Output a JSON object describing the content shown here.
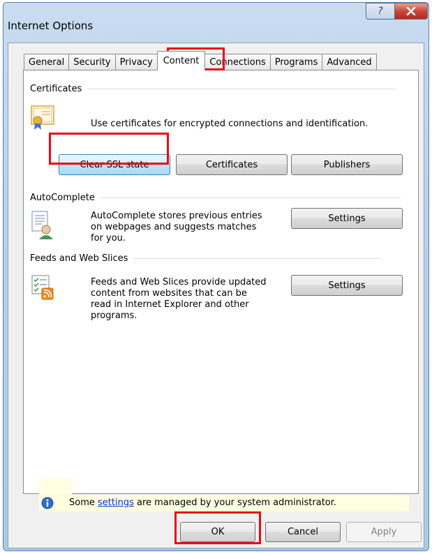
{
  "window": {
    "title": "Internet Options"
  },
  "titlebar": {
    "help_glyph": "?",
    "close_glyph": "X"
  },
  "tabs": [
    {
      "label": "General"
    },
    {
      "label": "Security"
    },
    {
      "label": "Privacy"
    },
    {
      "label": "Content"
    },
    {
      "label": "Connections"
    },
    {
      "label": "Programs"
    },
    {
      "label": "Advanced"
    }
  ],
  "active_tab": "Content",
  "certificates": {
    "heading": "Certificates",
    "description": "Use certificates for encrypted connections and identification.",
    "clear_ssl_label": "Clear SSL state",
    "certificates_label": "Certificates",
    "publishers_label": "Publishers"
  },
  "autocomplete": {
    "heading": "AutoComplete",
    "description_line1": "AutoComplete stores previous entries",
    "description_line2": "on webpages and suggests matches",
    "description_line3": "for you.",
    "settings_label": "Settings"
  },
  "feeds": {
    "heading": "Feeds and Web Slices",
    "description_line1": "Feeds and Web Slices provide updated",
    "description_line2": "content from websites that can be",
    "description_line3": "read in Internet Explorer and other",
    "description_line4": "programs.",
    "settings_label": "Settings"
  },
  "info": {
    "text_before": "Some ",
    "link": "settings",
    "text_after": " are managed by your system administrator."
  },
  "footer": {
    "ok_label": "OK",
    "cancel_label": "Cancel",
    "apply_label": "Apply"
  },
  "colors": {
    "highlight": "#e8081a",
    "link": "#0033cc",
    "info_bg": "#ffffe1"
  }
}
